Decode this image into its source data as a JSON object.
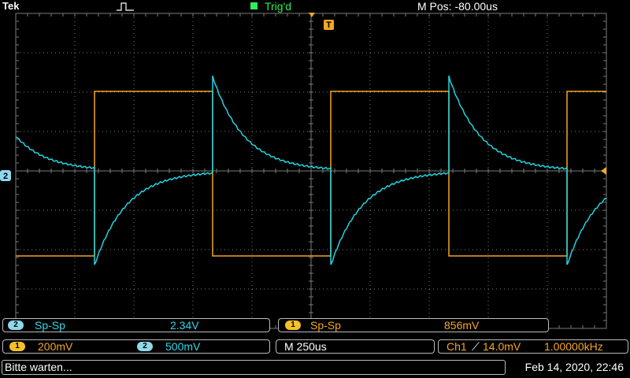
{
  "header": {
    "brand": "Tek",
    "trigger_status": "Trig'd",
    "position": "M Pos: -80.00us",
    "trigger_color": "#2eee5c"
  },
  "markers": {
    "ch2_label": "2",
    "trigger_marker": "T"
  },
  "traces": {
    "ch1_color": "#f5a623",
    "ch2_color": "#22d3e0",
    "grid_color": "#7a7a7a"
  },
  "measurements": [
    {
      "channel": "2",
      "type": "Sp-Sp",
      "value": "2.34V"
    },
    {
      "channel": "1",
      "type": "Sp-Sp",
      "value": "856mV"
    }
  ],
  "settings": {
    "ch1_channel": "1",
    "ch1_scale": "200mV",
    "ch2_channel": "2",
    "ch2_scale": "500mV",
    "timebase": "M 250us",
    "trigger_source": "Ch1",
    "trigger_slope": "⟋",
    "trigger_level": "14.0mV",
    "frequency": "1.00000kHz"
  },
  "status": {
    "message": "Bitte warten...",
    "datetime": "Feb 14, 2020, 22:46"
  }
}
